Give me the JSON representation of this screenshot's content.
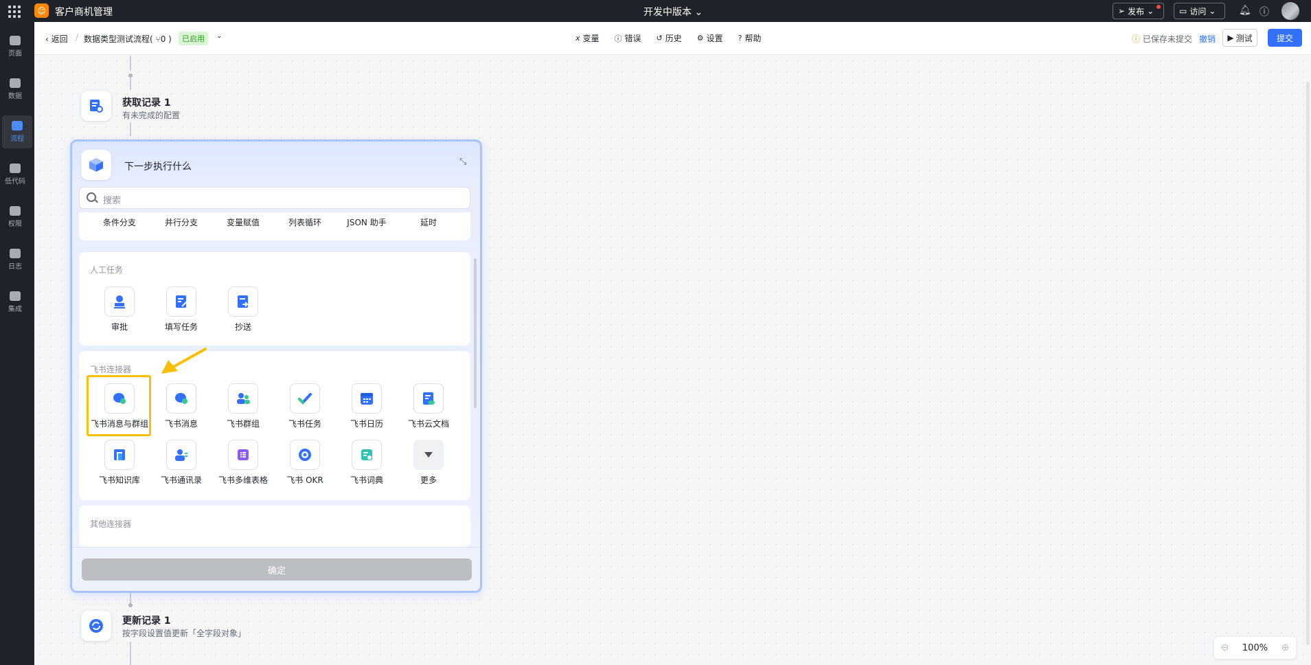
{
  "topbar": {
    "app_name": "客户商机管理",
    "version": "开发中版本 ⌄",
    "publish": "发布",
    "visit": "访问"
  },
  "leftnav": [
    "页面",
    "数据",
    "流程",
    "低代码",
    "权限",
    "日志",
    "集成"
  ],
  "subheader": {
    "back": "返回",
    "flow_title": "数据类型测试流程( ⑂0 )",
    "status": "已启用",
    "tools": [
      "变量",
      "错误",
      "历史",
      "设置",
      "帮助"
    ],
    "saved_note": "已保存未提交",
    "undo": "撤销",
    "test": "测试",
    "submit": "提交"
  },
  "nodes": {
    "get_record": {
      "title": "获取记录 1",
      "subtitle": "有未完成的配置"
    },
    "update_record": {
      "title": "更新记录 1",
      "subtitle": "按字段设置值更新「全字段对象」"
    }
  },
  "panel": {
    "title": "下一步执行什么",
    "search_placeholder": "搜索",
    "flow_items": [
      "条件分支",
      "并行分支",
      "变量赋值",
      "列表循环",
      "JSON 助手",
      "延时"
    ],
    "manual": {
      "title": "人工任务",
      "items": [
        "审批",
        "填写任务",
        "抄送"
      ]
    },
    "feishu": {
      "title": "飞书连接器",
      "items": [
        "飞书消息与群组",
        "飞书消息",
        "飞书群组",
        "飞书任务",
        "飞书日历",
        "飞书云文档",
        "飞书知识库",
        "飞书通讯录",
        "飞书多维表格",
        "飞书 OKR",
        "飞书词典",
        "更多"
      ]
    },
    "other": {
      "title": "其他连接器"
    },
    "confirm": "确定"
  },
  "zoom": {
    "level": "100%"
  },
  "colors": {
    "accent": "#3370ff",
    "highlight": "#fbbf08",
    "topbar": "#1f2329"
  }
}
